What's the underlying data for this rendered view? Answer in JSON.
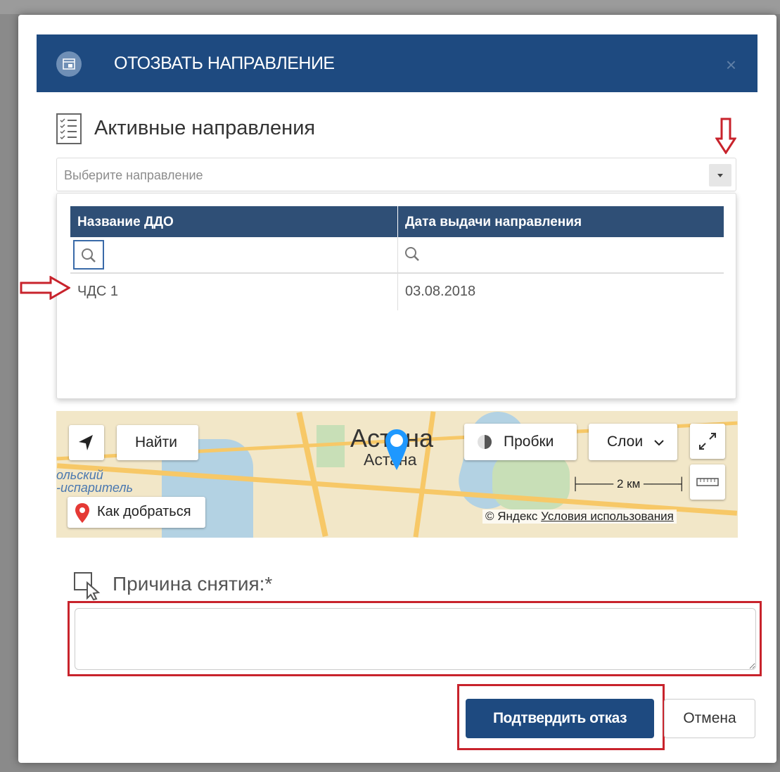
{
  "dialog": {
    "title": "ОТОЗВАТЬ НАПРАВЛЕНИЕ",
    "close_label": "×"
  },
  "active_directions": {
    "heading": "Активные направления",
    "select_placeholder": "Выберите направление",
    "table": {
      "columns": [
        "Название ДДО",
        "Дата выдачи направления"
      ],
      "rows": [
        {
          "name": "ЧДС 1",
          "date": "03.08.2018"
        }
      ]
    }
  },
  "map": {
    "find_label": "Найти",
    "traffic_label": "Пробки",
    "layers_label": "Слои",
    "route_label": "Как добраться",
    "city_label": "Астана",
    "city_label_small": "Астана",
    "lake_label_1": "ольский",
    "lake_label_2": "-испаритель",
    "scale_label": "2 км",
    "copyright": "© Яндекс",
    "terms_link": "Условия использования"
  },
  "reason": {
    "label": "Причина снятия:*",
    "value": ""
  },
  "buttons": {
    "confirm": "Подтвердить отказ",
    "cancel": "Отмена"
  },
  "colors": {
    "header": "#1e4a80",
    "grid_header": "#2f4f76",
    "annotation_red": "#c8232c"
  }
}
